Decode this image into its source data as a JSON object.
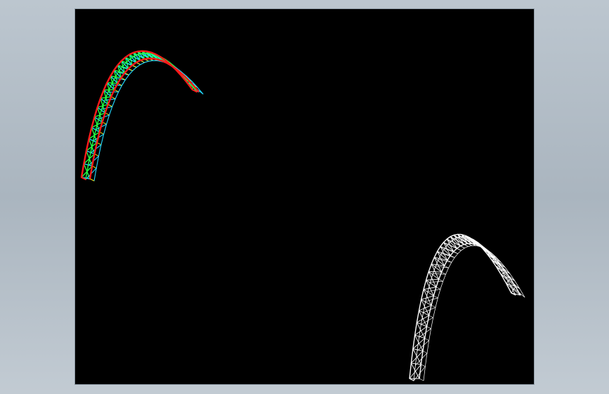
{
  "colors": {
    "page_background": "#b4bec8",
    "viewport_background": "#000000",
    "colored_truss": {
      "chord": "#ff1a1a",
      "web": "#22ff44",
      "strut": "#22d8ff",
      "accent": "#ffe600"
    },
    "wireframe_truss": "#ffffff"
  },
  "objects": [
    {
      "name": "colored-arch-truss",
      "render_mode": "shaded-color"
    },
    {
      "name": "wireframe-arch-truss",
      "render_mode": "white-wireframe"
    }
  ]
}
